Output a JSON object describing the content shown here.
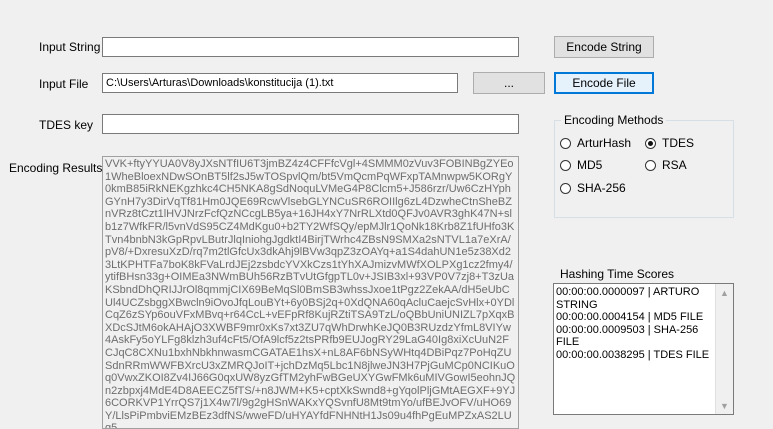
{
  "form": {
    "input_string_label": "Input String",
    "input_string_value": "",
    "encode_string_button": "Encode String",
    "input_file_label": "Input File",
    "input_file_value": "C:\\Users\\Arturas\\Downloads\\konstitucija (1).txt",
    "browse_button": "...",
    "encode_file_button": "Encode File",
    "tdes_key_label": "TDES key",
    "tdes_key_value": "",
    "encoding_results_label": "Encoding Results",
    "encoding_results_text": "VVK+ftyYYUA0V8yJXsNTfIU6T3jmBZ4z4CFFfcVgl+4SMMM0zVuv3FOBINBgZYEo1WheBloexNDwSOnBT5lf2sJ5wTOSpvlQm/bt5VmQcmPqWFxpTAMnwpw5KORgY0kmB85iRkNEKgzhkc4CH5NKA8gSdNoquLVMeG4P8Clcm5+J586rzr/Uw6CzHYphGYnH7y3DirVqTf81Hm0JQE69RcwVlsebGLYNCuSR6ROIIlg6zL4DzwheCtnSheBZnVRz8tCzt1lHVJNrzFcfQzNCcgLB5ya+16JH4xY7NrRLXtd0QFJv0AVR3ghK47N+slb1z7WfkFR/l5vnVdS95CZ4MdKgu0+b2TY2WfSQy/epMJlr1QoNk18Krb8Z1fUHfo3KTvn4bnbN3kGpRpvLButrJlqIniohgJgdktI4BirjTWrhc4ZBsN9SMXa2sNTVL1a7eXrA/pV8/+DxresuXzD/rq7m2tlGfcUx3dkAhj9lBVw3qpZ3zOAYq+a1S4dahUN1e5z38Xd23LtKPHTFa7boK8kFVaLrdJEj2zsbdcYVXkCzs1tYhXAJmizvMWfXOLPXg1cz2fmy4/ytifBHsn33g+OIMEa3NWmBUh56RzBTvUtGfgpTL0v+JSIB3xl+93VP0V7zj8+T3zUaKSbndDhQRIJJrOl8qmmjCIX69BeMqSl0BmSB3whssJxoe1tPgz2ZekAA/dH5eUbCUl4UCZsbggXBwcln9iOvoJfqLouBYt+6y0BSj2q+0XdQNA60qAcluCaejcSvHlx+0YDlCqZ6zSYp6ouVFxMBvq+r64CcL+vEFpRf8KujRZtiTSA9TzL/oQBbUniUNIZL7pXqxBXDcSJtM6okAHAjO3XWBF9mr0xKs7xt3ZU7qWhDrwhKeJQ0B3RUzdzYfmL8VIYw4AskFy5oYLFg8klzh3uf4cFt5/OfA9lcf5z2tsPRfb9EUJogRY29LaG40Ig8xiXcUuN2FCJqC8CXNu1bxhNbkhnwasmCGATAE1hsX+nL8AF6bNSyWHtq4DBiPqz7PoHqZUSdnRRmWWFBXrcU3xZMRQJoIT+jchDzMq5Lbc1N8jlweJN3H7PjGuMCp0NCIKuOq0VwxZKOI8Zv4IJ66G0qxUW8yzGfTM2yhFwBGeUXYGwFMk6uMIVGowI5eohnJQn2zbpxj4MdE4D8AEECZ5fTS/+n8JWM+K5+cptXkSwnd8+gYqolPljGMtAEGXF+9YJ6CORKVP1YrrQS7j1X4w7l/9g2gHSnWAKxYQSvnfU8Mt9tmYo/ufBEJvOFV/uHO69Y/LlsPiPmbviEMzBEz3dfNS/wweFD/uHYAYfdFNHNtH1Js09u4fhPgEuMPZxAS2LUg5"
  },
  "encoding_methods": {
    "title": "Encoding Methods",
    "options": [
      {
        "label": "ArturHash",
        "checked": false
      },
      {
        "label": "TDES",
        "checked": true
      },
      {
        "label": "MD5",
        "checked": false
      },
      {
        "label": "RSA",
        "checked": false
      },
      {
        "label": "SHA-256",
        "checked": false
      }
    ]
  },
  "hashing_times": {
    "title": "Hashing Time Scores",
    "entries": [
      "00:00:00.0000097 | ARTURO STRING",
      "00:00:00.0004154 | MD5 FILE",
      "00:00:00.0009503 | SHA-256 FILE",
      "00:00:00.0038295 | TDES FILE"
    ]
  }
}
